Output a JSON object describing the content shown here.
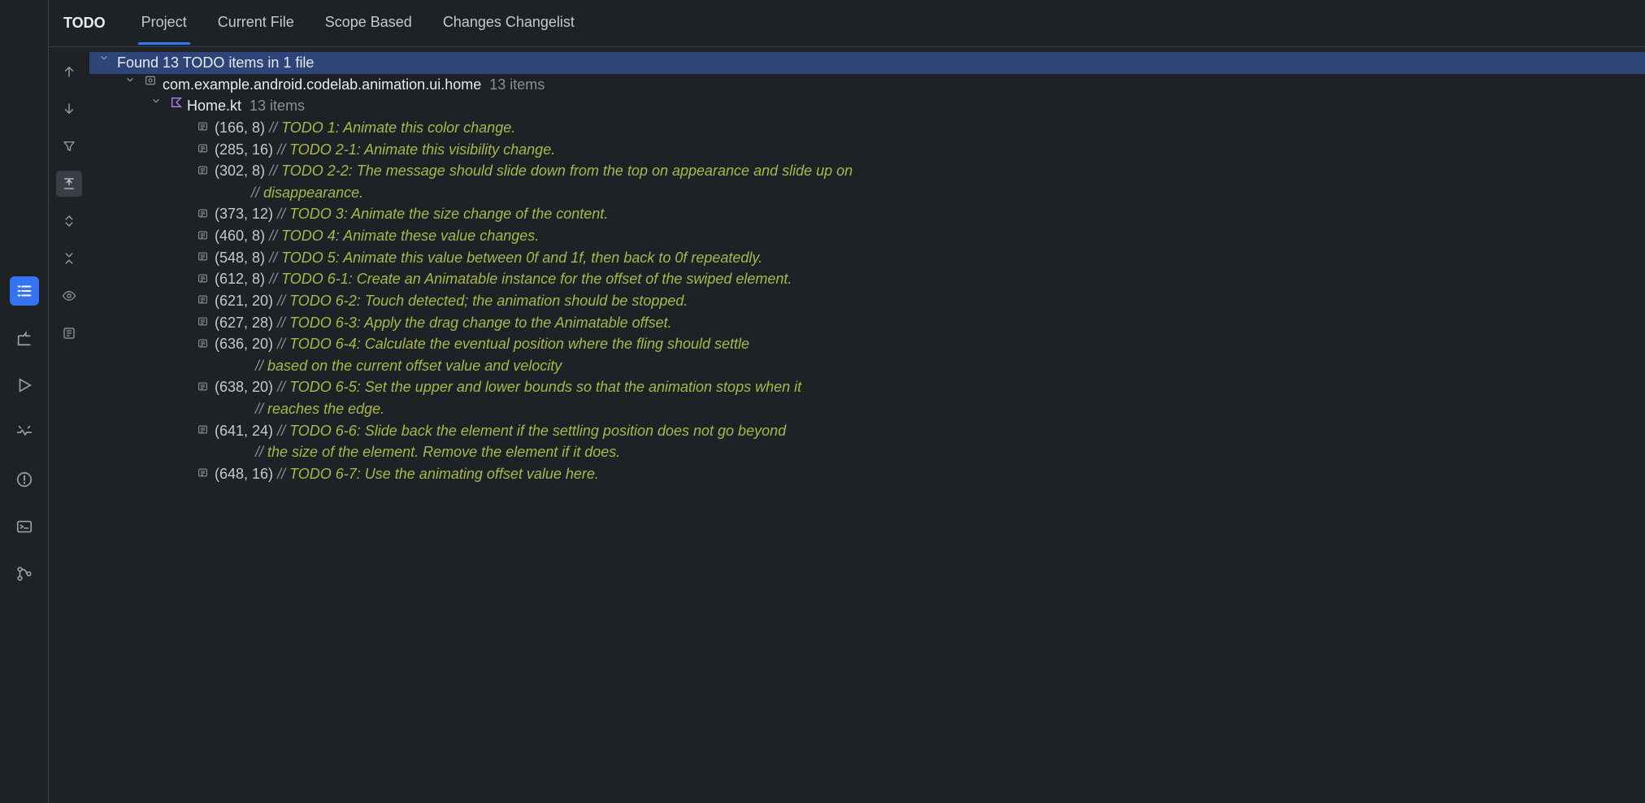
{
  "panelTitle": "TODO",
  "tabs": {
    "project": "Project",
    "currentFile": "Current File",
    "scopeBased": "Scope Based",
    "changes": "Changes Changelist"
  },
  "summary": "Found 13 TODO items in 1 file",
  "package": {
    "name": "com.example.android.codelab.animation.ui.home",
    "count": "13 items"
  },
  "file": {
    "name": "Home.kt",
    "count": "13 items"
  },
  "items": [
    {
      "coord": "(166, 8)",
      "pad": " ",
      "text": "TODO 1: Animate this color change."
    },
    {
      "coord": "(285, 16)",
      "pad": " ",
      "text": "TODO 2-1: Animate this visibility change."
    },
    {
      "coord": "(302, 8)",
      "pad": "       ",
      "text": "TODO 2-2: The message should slide down from the top on appearance and slide up on",
      "cont": [
        {
          "pad": "                  ",
          "text": "disappearance."
        }
      ]
    },
    {
      "coord": "(373, 12)",
      "pad": " ",
      "text": "TODO 3: Animate the size change of the content."
    },
    {
      "coord": "(460, 8)",
      "pad": " ",
      "text": "TODO 4: Animate these value changes."
    },
    {
      "coord": "(548, 8)",
      "pad": " ",
      "text": "TODO 5: Animate this value between 0f and 1f, then back to 0f repeatedly."
    },
    {
      "coord": "(612, 8)",
      "pad": " ",
      "text": "TODO 6-1: Create an Animatable instance for the offset of the swiped element."
    },
    {
      "coord": "(621, 20)",
      "pad": " ",
      "text": "TODO 6-2: Touch detected; the animation should be stopped."
    },
    {
      "coord": "(627, 28)",
      "pad": " ",
      "text": "TODO 6-3: Apply the drag change to the Animatable offset."
    },
    {
      "coord": "(636, 20)",
      "pad": "       ",
      "text": "TODO 6-4: Calculate the eventual position where the fling should settle",
      "cont": [
        {
          "pad": "                  ",
          "text": "based on the current offset value and velocity"
        }
      ]
    },
    {
      "coord": "(638, 20)",
      "pad": "       ",
      "text": "TODO 6-5: Set the upper and lower bounds so that the animation stops when it",
      "cont": [
        {
          "pad": "                  ",
          "text": "reaches the edge."
        }
      ]
    },
    {
      "coord": "(641, 24)",
      "pad": "       ",
      "text": "TODO 6-6: Slide back the element if the settling position does not go beyond",
      "cont": [
        {
          "pad": "                  ",
          "text": "the size of the element. Remove the element if it does."
        }
      ]
    },
    {
      "coord": "(648, 16)",
      "pad": " ",
      "text": "TODO 6-7: Use the animating offset value here."
    }
  ]
}
